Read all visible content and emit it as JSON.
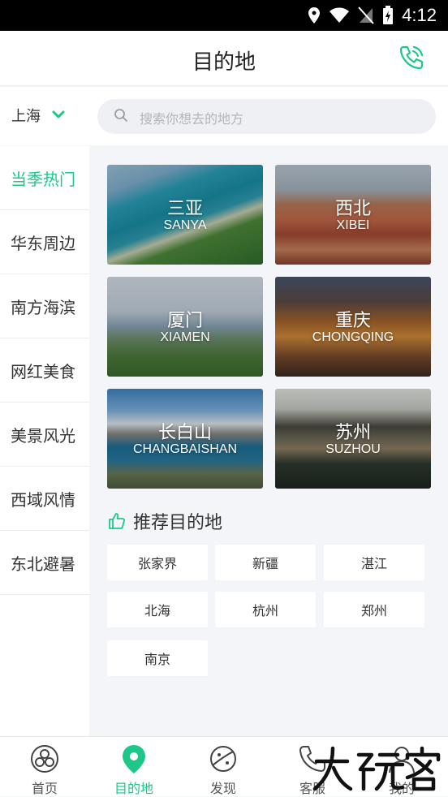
{
  "status_bar": {
    "time": "4:12"
  },
  "header": {
    "title": "目的地"
  },
  "search": {
    "city": "上海",
    "placeholder": "搜索你想去的地方"
  },
  "categories": [
    {
      "label": "当季热门",
      "active": true
    },
    {
      "label": "华东周边",
      "active": false
    },
    {
      "label": "南方海滨",
      "active": false
    },
    {
      "label": "网红美食",
      "active": false
    },
    {
      "label": "美景风光",
      "active": false
    },
    {
      "label": "西域风情",
      "active": false
    },
    {
      "label": "东北避暑",
      "active": false
    }
  ],
  "destinations": [
    {
      "name_cn": "三亚",
      "name_en": "SANYA"
    },
    {
      "name_cn": "西北",
      "name_en": "XIBEI"
    },
    {
      "name_cn": "厦门",
      "name_en": "XIAMEN"
    },
    {
      "name_cn": "重庆",
      "name_en": "CHONGQING"
    },
    {
      "name_cn": "长白山",
      "name_en": "CHANGBAISHAN"
    },
    {
      "name_cn": "苏州",
      "name_en": "SUZHOU"
    }
  ],
  "recommend": {
    "title": "推荐目的地",
    "tags": [
      "张家界",
      "新疆",
      "湛江",
      "北海",
      "杭州",
      "郑州",
      "南京"
    ]
  },
  "tabbar": {
    "tabs": [
      {
        "label": "首页",
        "icon": "home-icon",
        "active": false
      },
      {
        "label": "目的地",
        "icon": "location-pin-icon",
        "active": true
      },
      {
        "label": "发现",
        "icon": "planet-icon",
        "active": false
      },
      {
        "label": "客服",
        "icon": "phone-icon",
        "active": false
      },
      {
        "label": "我的",
        "icon": "person-icon",
        "active": false
      }
    ]
  },
  "watermark": "大玩家",
  "colors": {
    "accent": "#1ec787",
    "background": "#f4f5f8"
  }
}
